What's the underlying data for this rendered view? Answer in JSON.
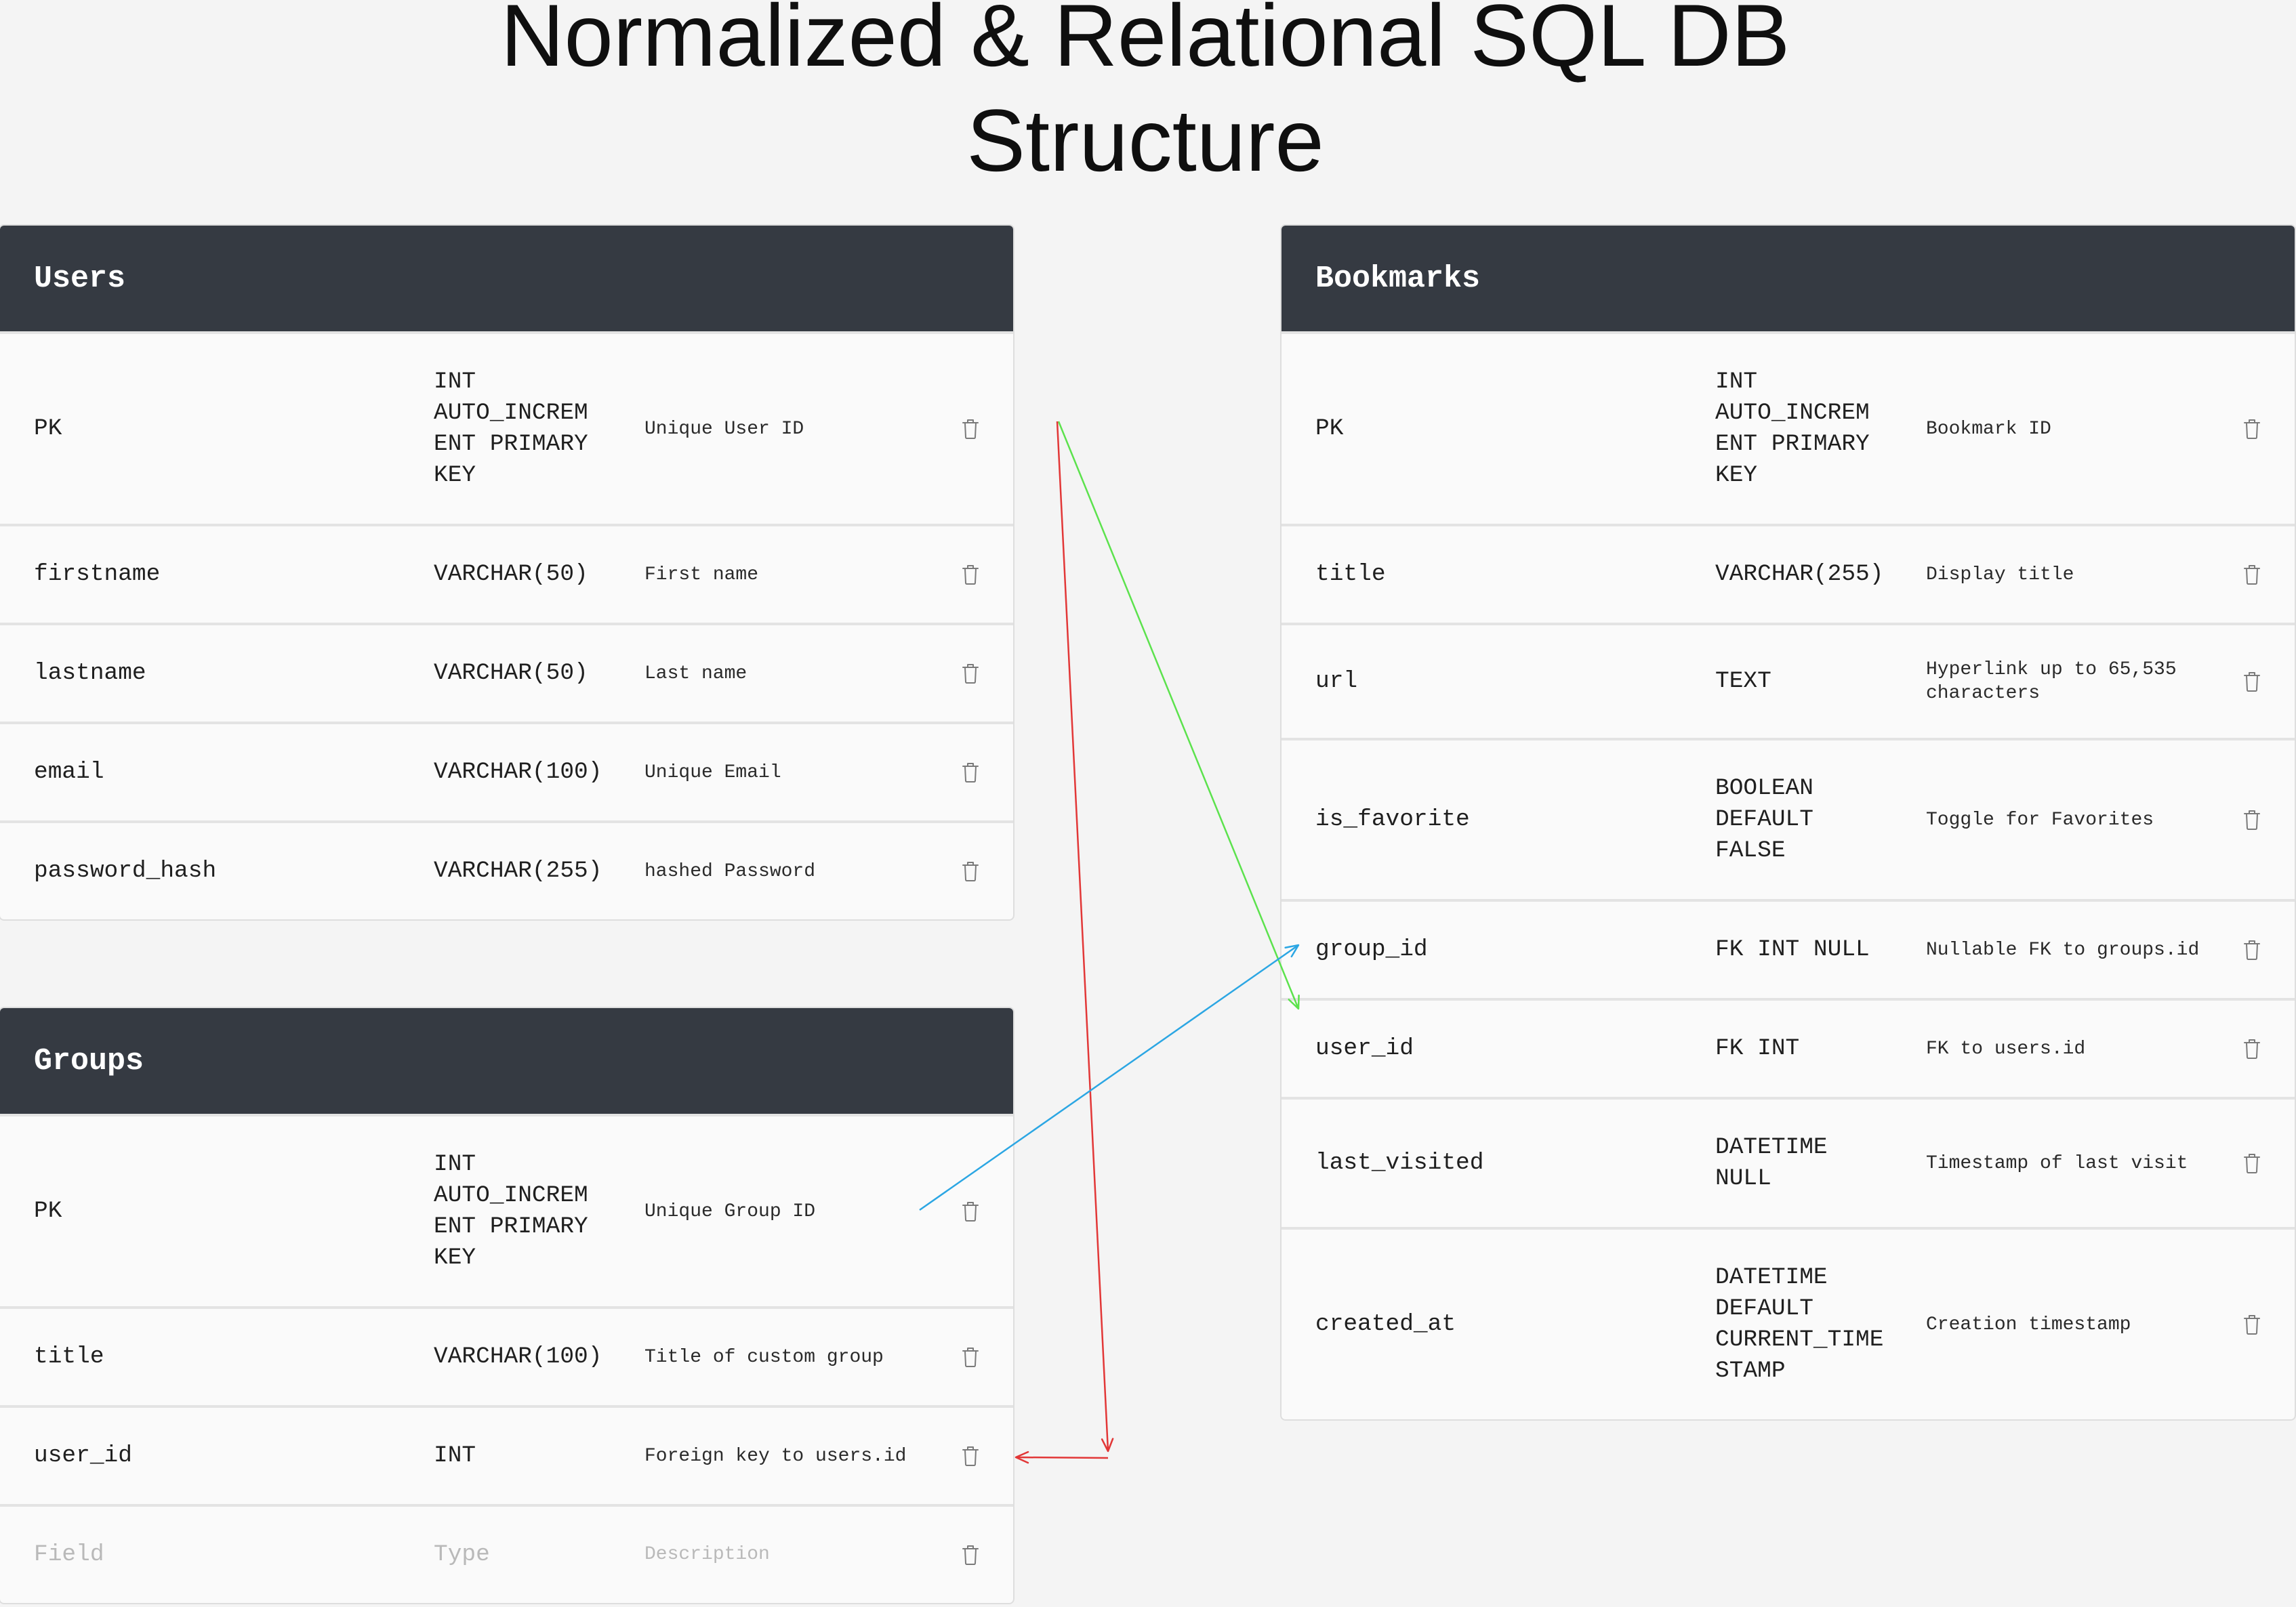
{
  "title": {
    "line1": "Normalized & Relational SQL DB",
    "line2": "Structure"
  },
  "colors": {
    "page_background": "#f4f4f4",
    "table_header": "#353a42",
    "arrow_users_to_bookmarks": "#5ce24d",
    "arrow_users_to_groups": "#e23737",
    "arrow_groups_to_bookmarks": "#2ba6e3"
  },
  "icons": {
    "row_delete": "trash-icon"
  },
  "tables": {
    "users": {
      "name": "Users",
      "rows": [
        {
          "field": "PK",
          "type": "INT AUTO_INCREM​ENT PRIMARY KEY",
          "description": "Unique User ID"
        },
        {
          "field": "firstname",
          "type": "VARCHAR(50)",
          "description": "First name"
        },
        {
          "field": "lastname",
          "type": "VARCHAR(50)",
          "description": "Last name"
        },
        {
          "field": "email",
          "type": "VARCHAR(100)",
          "description": "Unique Email"
        },
        {
          "field": "password_hash",
          "type": "VARCHAR(255)",
          "description": "hashed Password"
        }
      ]
    },
    "groups": {
      "name": "Groups",
      "rows": [
        {
          "field": "PK",
          "type": "INT AUTO_INCREM​ENT PRIMARY KEY",
          "description": "Unique Group ID"
        },
        {
          "field": "title",
          "type": "VARCHAR(100)",
          "description": "Title of custom group"
        },
        {
          "field": "user_id",
          "type": "INT",
          "description": "Foreign key to users.id"
        }
      ],
      "new_row": {
        "field_placeholder": "Field",
        "type_placeholder": "Type",
        "description_placeholder": "Description"
      }
    },
    "bookmarks": {
      "name": "Bookmarks",
      "rows": [
        {
          "field": "PK",
          "type": "INT AUTO_INCREM​ENT PRIMARY KEY",
          "description": "Bookmark ID"
        },
        {
          "field": "title",
          "type": "VARCHAR(255)",
          "description": "Display title"
        },
        {
          "field": "url",
          "type": "TEXT",
          "description": "Hyperlink up to 65,535 characters"
        },
        {
          "field": "is_favorite",
          "type": "BOOLEAN DEFAULT FALSE",
          "description": "Toggle for Favorites"
        },
        {
          "field": "group_id",
          "type": "FK INT NULL",
          "description": "Nullable FK to groups.id"
        },
        {
          "field": "user_id",
          "type": "FK INT",
          "description": "FK to users.id"
        },
        {
          "field": "last_visited",
          "type": "DATETIME NULL",
          "description": "Timestamp of last visit"
        },
        {
          "field": "created_at",
          "type": "DATETIME DEFAULT CURRENT_TIMESTAMP",
          "description": "Creation timestamp"
        }
      ]
    }
  }
}
